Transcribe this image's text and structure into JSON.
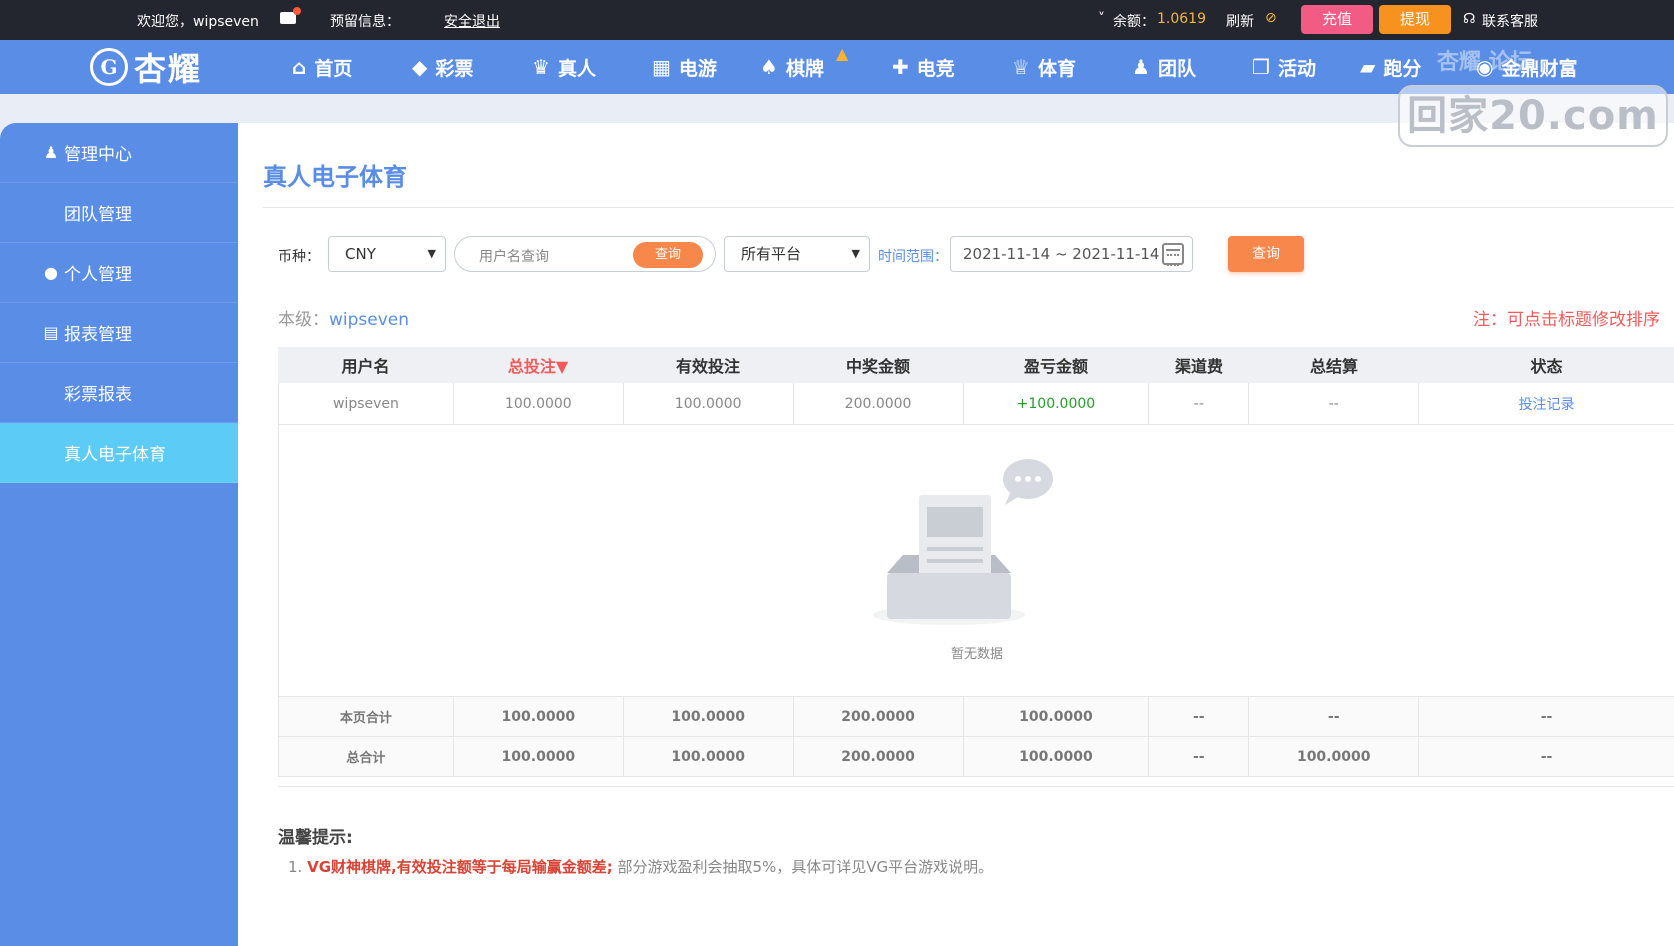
{
  "topbar": {
    "welcome": "欢迎您，wipseven",
    "reserved_label": "预留信息：",
    "logout": "安全退出",
    "balance_label": "余额：",
    "balance_value": "1.0619",
    "refresh": "刷新",
    "recharge": "充值",
    "withdraw": "提现",
    "support": "联系客服"
  },
  "logo": {
    "brand": "杏耀",
    "emblem": "G"
  },
  "nav": [
    {
      "label": "首页",
      "icon": "home-icon",
      "glyph": "⌂"
    },
    {
      "label": "彩票",
      "icon": "ticket-icon",
      "glyph": "◆"
    },
    {
      "label": "真人",
      "icon": "dealer-icon",
      "glyph": "♛"
    },
    {
      "label": "电游",
      "icon": "slot-icon",
      "glyph": "▦"
    },
    {
      "label": "棋牌",
      "icon": "cards-icon",
      "glyph": "♠"
    },
    {
      "label": "电竞",
      "icon": "gamepad-icon",
      "glyph": "✚"
    },
    {
      "label": "体育",
      "icon": "trophy-icon",
      "glyph": "♕"
    },
    {
      "label": "团队",
      "icon": "team-icon",
      "glyph": "♟"
    },
    {
      "label": "活动",
      "icon": "gift-icon",
      "glyph": "❒"
    },
    {
      "label": "跑分",
      "icon": "car-icon",
      "glyph": "▰"
    },
    {
      "label": "金鼎财富",
      "icon": "coin-icon",
      "glyph": "◉"
    }
  ],
  "watermark": {
    "top": "杏耀 论坛",
    "main": "回家20.com"
  },
  "sidebar": {
    "items": [
      {
        "label": "管理中心",
        "icon": "users-icon",
        "glyph": "♟"
      },
      {
        "label": "团队管理"
      },
      {
        "label": "个人管理",
        "icon": "user-icon",
        "glyph": "●"
      },
      {
        "label": "报表管理",
        "icon": "report-icon",
        "glyph": "▤"
      },
      {
        "label": "彩票报表"
      },
      {
        "label": "真人电子体育"
      }
    ]
  },
  "main": {
    "title": "真人电子体育",
    "filters": {
      "currency_label": "币种：",
      "currency_value": "CNY",
      "username_placeholder": "用户名查询",
      "username_search": "查询",
      "platform_value": "所有平台",
      "time_label": "时间范围：",
      "time_value": "2021-11-14 ~ 2021-11-14",
      "query": "查询"
    },
    "level_label": "本级：",
    "level_user": "wipseven",
    "note": "注：可点击标题修改排序",
    "table": {
      "headers": [
        "用户名",
        "总投注▼",
        "有效投注",
        "中奖金额",
        "盈亏金额",
        "渠道费",
        "总结算",
        "状态"
      ],
      "rows": [
        [
          "wipseven",
          "100.0000",
          "100.0000",
          "200.0000",
          "+100.0000",
          "--",
          "--",
          "投注记录"
        ]
      ],
      "empty_text": "暂无数据",
      "page_total": [
        "本页合计",
        "100.0000",
        "100.0000",
        "200.0000",
        "100.0000",
        "--",
        "--",
        "--"
      ],
      "grand_total": [
        "总合计",
        "100.0000",
        "100.0000",
        "200.0000",
        "100.0000",
        "--",
        "100.0000",
        "--"
      ]
    },
    "tips": {
      "title": "温馨提示:",
      "items": [
        {
          "index": "1.",
          "strong": "VG财神棋牌,有效投注额等于每局输赢金额差;",
          "text": " 部分游戏盈利会抽取5%，具体可详见VG平台游戏说明。"
        }
      ]
    }
  },
  "colors": {
    "primary": "#5a8ee6",
    "active": "#5ccbf5",
    "accent": "#f7874a",
    "danger": "#f25b5b",
    "win": "#2a9c2a"
  }
}
